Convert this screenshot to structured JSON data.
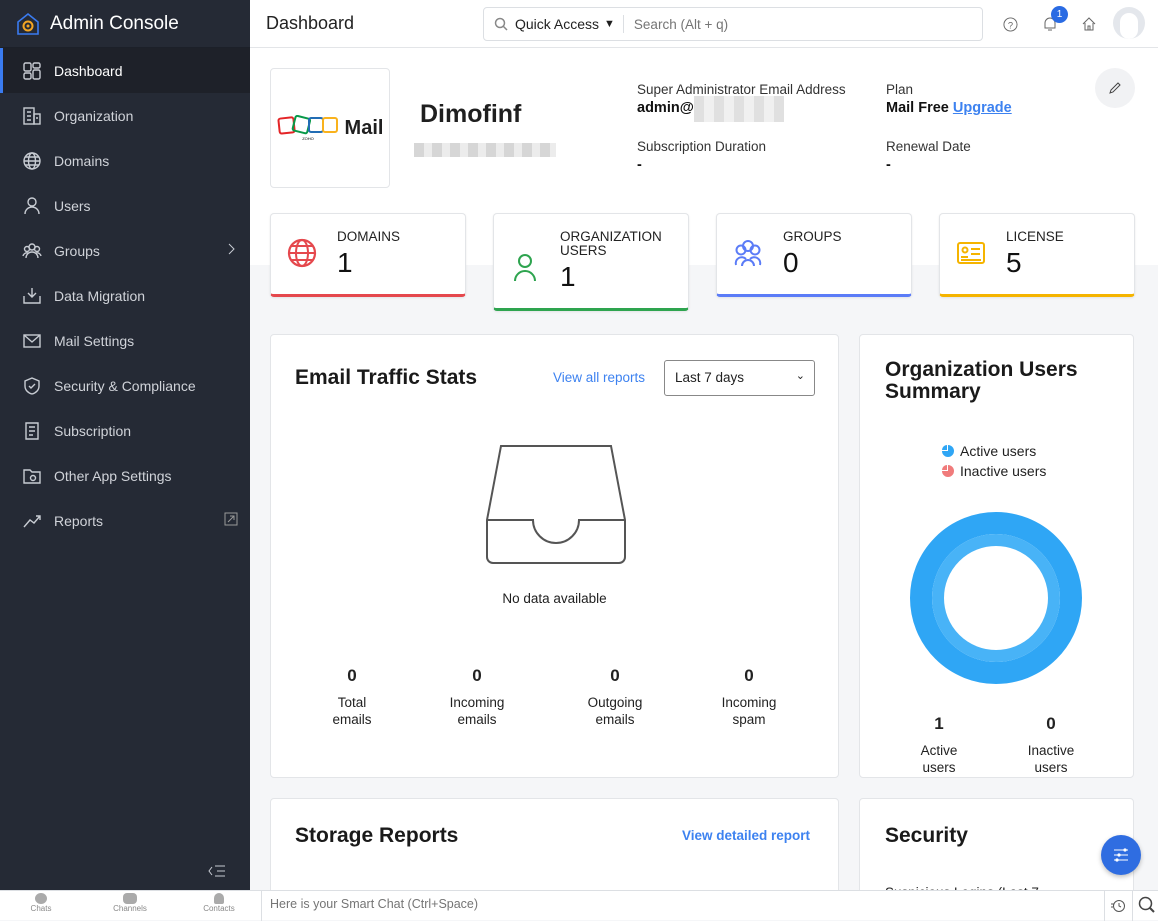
{
  "app": {
    "title": "Admin Console"
  },
  "sidebar": {
    "items": [
      {
        "label": "Dashboard",
        "icon": "dashboard-icon",
        "active": true
      },
      {
        "label": "Organization",
        "icon": "building-icon"
      },
      {
        "label": "Domains",
        "icon": "globe-icon"
      },
      {
        "label": "Users",
        "icon": "user-icon"
      },
      {
        "label": "Groups",
        "icon": "groups-icon"
      },
      {
        "label": "Data Migration",
        "icon": "download-tray-icon"
      },
      {
        "label": "Mail Settings",
        "icon": "mail-gear-icon"
      },
      {
        "label": "Security & Compliance",
        "icon": "shield-icon"
      },
      {
        "label": "Subscription",
        "icon": "receipt-icon"
      },
      {
        "label": "Other App Settings",
        "icon": "folder-gear-icon"
      },
      {
        "label": "Reports",
        "icon": "trend-icon"
      }
    ]
  },
  "header": {
    "title": "Dashboard",
    "quick_access": "Quick Access",
    "search_placeholder": "Search (Alt + q)",
    "notification_count": "1"
  },
  "profile": {
    "logo_text": "Mail",
    "logo_brand": "ZOHO",
    "org_name": "Dimofinf",
    "email_label": "Super Administrator Email Address",
    "email_value": "admin@",
    "plan_label": "Plan",
    "plan_value": "Mail Free",
    "upgrade": "Upgrade",
    "duration_label": "Subscription Duration",
    "duration_value": "-",
    "renewal_label": "Renewal Date",
    "renewal_value": "-"
  },
  "stats": [
    {
      "label": "DOMAINS",
      "value": "1",
      "color": "#e5484d"
    },
    {
      "label": "ORGANIZATION USERS",
      "value": "1",
      "color": "#2ea44f"
    },
    {
      "label": "GROUPS",
      "value": "0",
      "color": "#5b7cf7"
    },
    {
      "label": "LICENSE",
      "value": "5",
      "color": "#f5b400"
    }
  ],
  "traffic": {
    "title": "Email Traffic Stats",
    "view_all": "View all reports",
    "range": "Last 7 days",
    "empty": "No data available",
    "metrics": [
      {
        "value": "0",
        "label": "Total emails"
      },
      {
        "value": "0",
        "label": "Incoming emails"
      },
      {
        "value": "0",
        "label": "Outgoing emails"
      },
      {
        "value": "0",
        "label": "Incoming spam"
      }
    ]
  },
  "users_summary": {
    "title": "Organization Users Summary",
    "legend": [
      {
        "label": "Active users",
        "color": "#2fa6f5"
      },
      {
        "label": "Inactive users",
        "color": "#f07b7b"
      }
    ],
    "metrics": [
      {
        "value": "1",
        "label": "Active users"
      },
      {
        "value": "0",
        "label": "Inactive users"
      }
    ],
    "chart_data": {
      "type": "pie",
      "categories": [
        "Active users",
        "Inactive users"
      ],
      "values": [
        1,
        0
      ]
    }
  },
  "storage": {
    "title": "Storage Reports",
    "link": "View detailed report"
  },
  "security": {
    "title": "Security",
    "row": "Suspicious Logins (Last 7"
  },
  "bottom": {
    "chats": "Chats",
    "channels": "Channels",
    "contacts": "Contacts",
    "smart_chat": "Here is your Smart Chat (Ctrl+Space)"
  }
}
